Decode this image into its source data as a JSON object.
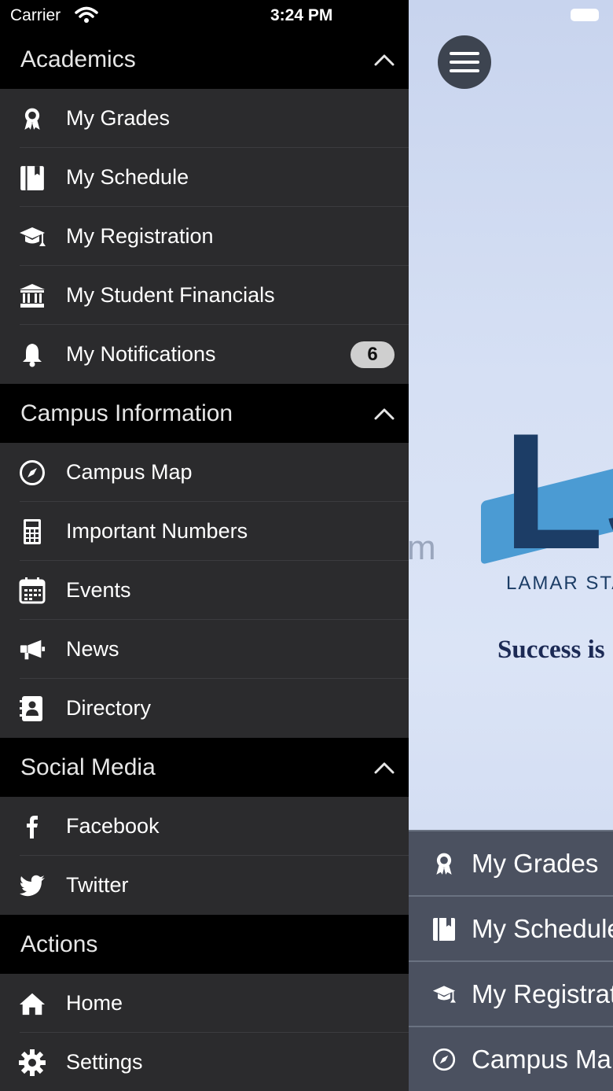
{
  "status_bar": {
    "carrier": "Carrier",
    "time": "3:24 PM"
  },
  "drawer": {
    "sections": [
      {
        "title": "Academics",
        "items": [
          {
            "label": "My Grades",
            "icon": "award-icon"
          },
          {
            "label": "My Schedule",
            "icon": "book-icon"
          },
          {
            "label": "My Registration",
            "icon": "graduation-cap-icon"
          },
          {
            "label": "My Student Financials",
            "icon": "bank-icon"
          },
          {
            "label": "My Notifications",
            "icon": "bell-icon",
            "badge": "6"
          }
        ]
      },
      {
        "title": "Campus Information",
        "items": [
          {
            "label": "Campus Map",
            "icon": "compass-icon"
          },
          {
            "label": "Important Numbers",
            "icon": "calculator-icon"
          },
          {
            "label": "Events",
            "icon": "calendar-icon"
          },
          {
            "label": "News",
            "icon": "megaphone-icon"
          },
          {
            "label": "Directory",
            "icon": "address-book-icon"
          }
        ]
      },
      {
        "title": "Social Media",
        "items": [
          {
            "label": "Facebook",
            "icon": "facebook-icon"
          },
          {
            "label": "Twitter",
            "icon": "twitter-icon"
          }
        ]
      },
      {
        "title": "Actions",
        "items": [
          {
            "label": "Home",
            "icon": "home-icon"
          },
          {
            "label": "Settings",
            "icon": "gear-icon"
          }
        ]
      }
    ]
  },
  "background": {
    "logo_letters": "LS",
    "logo_text": "LAMAR STA",
    "partial_text": "m",
    "tagline": "Success is",
    "quick_links": [
      {
        "label": "My Grades",
        "icon": "award-icon"
      },
      {
        "label": "My Schedule",
        "icon": "book-icon"
      },
      {
        "label": "My Registration",
        "icon": "graduation-cap-icon"
      },
      {
        "label": "Campus Map",
        "icon": "compass-icon"
      }
    ]
  }
}
